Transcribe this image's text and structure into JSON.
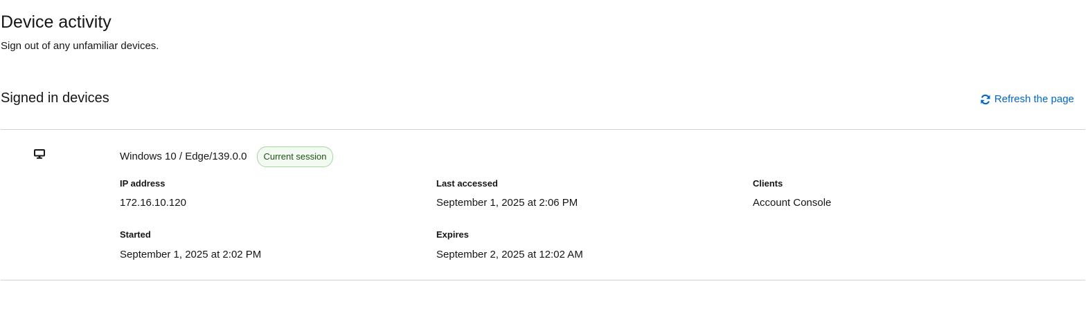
{
  "header": {
    "title": "Device activity",
    "subtitle": "Sign out of any unfamiliar devices."
  },
  "section": {
    "title": "Signed in devices",
    "refresh_label": "Refresh the page",
    "refresh_icon": "sync-icon"
  },
  "colors": {
    "link": "#0066cc",
    "badge_border": "#a3d89e",
    "badge_bg": "#f3faf2",
    "badge_text": "#1e4f18",
    "divider": "#d2d2d2"
  },
  "device": {
    "icon": "desktop-icon",
    "name": "Windows 10 / Edge/139.0.0",
    "badge": "Current session",
    "fields": {
      "ip_label": "IP address",
      "ip_value": "172.16.10.120",
      "last_accessed_label": "Last accessed",
      "last_accessed_value": "September 1, 2025 at 2:06 PM",
      "clients_label": "Clients",
      "clients_value": "Account Console",
      "started_label": "Started",
      "started_value": "September 1, 2025 at 2:02 PM",
      "expires_label": "Expires",
      "expires_value": "September 2, 2025 at 12:02 AM"
    }
  }
}
